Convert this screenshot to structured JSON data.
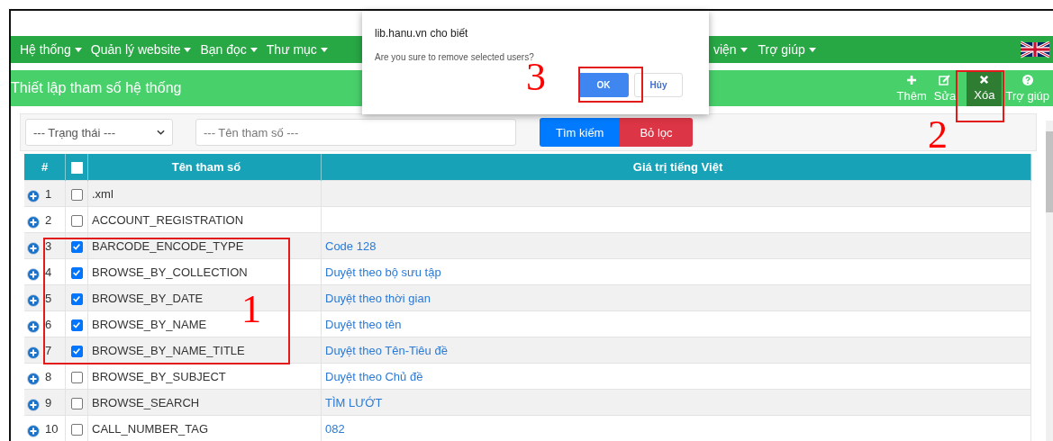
{
  "nav": {
    "left_items": [
      {
        "label": "Hệ thống"
      },
      {
        "label": "Quản lý website"
      },
      {
        "label": "Bạn đọc"
      },
      {
        "label": "Thư mục"
      }
    ],
    "right_items": [
      {
        "label": "viện"
      },
      {
        "label": "Trợ giúp"
      }
    ]
  },
  "header": {
    "title": "Thiết lập tham số hệ thống",
    "toolbar": [
      {
        "kind": "add",
        "label": "Thêm",
        "selected": false
      },
      {
        "kind": "edit",
        "label": "Sửa",
        "selected": false
      },
      {
        "kind": "delete",
        "label": "Xóa",
        "selected": true
      },
      {
        "kind": "help",
        "label": "Trợ giúp",
        "selected": false
      }
    ]
  },
  "filters": {
    "status_select": "--- Trạng thái ---",
    "name_placeholder": "--- Tên tham số ---",
    "search_button": "Tìm kiếm",
    "reset_button": "Bỏ lọc"
  },
  "table": {
    "columns": [
      "#",
      "Tên tham số",
      "Giá trị tiếng Việt"
    ],
    "header_checked": false,
    "rows": [
      {
        "index": "1",
        "checked": false,
        "name": ".xml",
        "value": ""
      },
      {
        "index": "2",
        "checked": false,
        "name": "ACCOUNT_REGISTRATION",
        "value": ""
      },
      {
        "index": "3",
        "checked": true,
        "name": "BARCODE_ENCODE_TYPE",
        "value": "Code 128"
      },
      {
        "index": "4",
        "checked": true,
        "name": "BROWSE_BY_COLLECTION",
        "value": "Duyệt theo bộ sưu tập"
      },
      {
        "index": "5",
        "checked": true,
        "name": "BROWSE_BY_DATE",
        "value": "Duyệt theo thời gian"
      },
      {
        "index": "6",
        "checked": true,
        "name": "BROWSE_BY_NAME",
        "value": "Duyệt theo tên"
      },
      {
        "index": "7",
        "checked": true,
        "name": "BROWSE_BY_NAME_TITLE",
        "value": "Duyệt theo Tên-Tiêu đề"
      },
      {
        "index": "8",
        "checked": false,
        "name": "BROWSE_BY_SUBJECT",
        "value": "Duyệt theo Chủ đề"
      },
      {
        "index": "9",
        "checked": false,
        "name": "BROWSE_SEARCH",
        "value": "TÌM LƯỚT"
      },
      {
        "index": "10",
        "checked": false,
        "name": "CALL_NUMBER_TAG",
        "value": "082"
      }
    ]
  },
  "dialog": {
    "title": "lib.hanu.vn cho biết",
    "message": "Are you sure to remove selected users?",
    "ok_button": "OK",
    "cancel_button": "Hủy"
  },
  "annotations": [
    {
      "label": "1"
    },
    {
      "label": "2"
    },
    {
      "label": "3"
    }
  ]
}
